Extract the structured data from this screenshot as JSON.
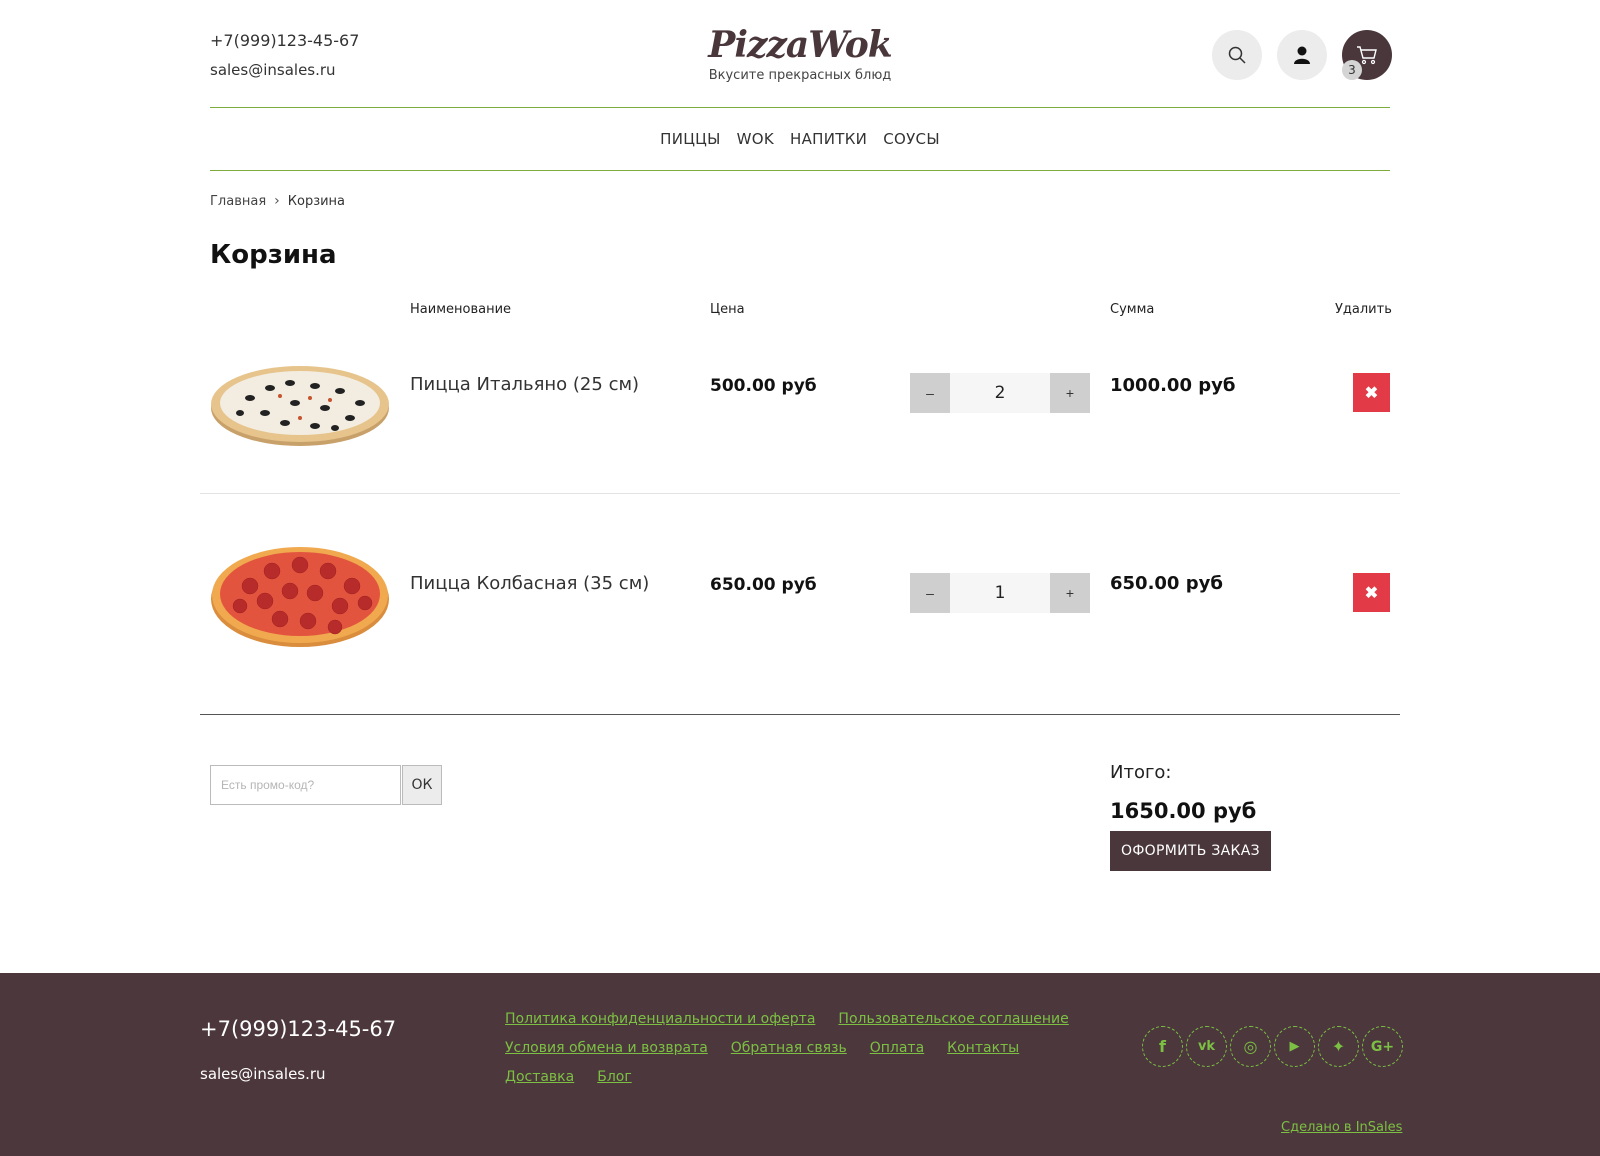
{
  "header": {
    "phone": "+7(999)123-45-67",
    "email": "sales@insales.ru",
    "logo": "PizzaWok",
    "slogan": "Вкусите прекрасных блюд",
    "cart_count": "3"
  },
  "nav": [
    "ПИЦЦЫ",
    "WOK",
    "НАПИТКИ",
    "СОУСЫ"
  ],
  "breadcrumb": {
    "home": "Главная",
    "current": "Корзина"
  },
  "page_title": "Корзина",
  "table_headers": {
    "name": "Наименование",
    "price": "Цена",
    "sum": "Сумма",
    "delete": "Удалить"
  },
  "items": [
    {
      "title": "Пицца Итальяно (25 см)",
      "price": "500.00 руб",
      "qty": "2",
      "sum": "1000.00 руб"
    },
    {
      "title": "Пицца Колбасная (35 см)",
      "price": "650.00 руб",
      "qty": "1",
      "sum": "650.00 руб"
    }
  ],
  "qty_minus": "–",
  "qty_plus": "+",
  "delete_glyph": "✖",
  "promo": {
    "placeholder": "Есть промо-код?",
    "button": "ОК"
  },
  "total": {
    "label": "Итого:",
    "amount": "1650.00 руб",
    "checkout": "ОФОРМИТЬ ЗАКАЗ"
  },
  "footer": {
    "phone": "+7(999)123-45-67",
    "email": "sales@insales.ru",
    "links": [
      "Политика конфиденциальности и оферта",
      "Пользовательское соглашение",
      "Условия обмена и возврата",
      "Обратная связь",
      "Оплата",
      "Контакты",
      "Доставка",
      "Блог"
    ],
    "socials": [
      {
        "icon": "facebook-icon",
        "glyph": "f"
      },
      {
        "icon": "vk-icon",
        "glyph": "vk"
      },
      {
        "icon": "instagram-icon",
        "glyph": "◎"
      },
      {
        "icon": "youtube-icon",
        "glyph": "▶"
      },
      {
        "icon": "twitter-icon",
        "glyph": "✦"
      },
      {
        "icon": "google-plus-icon",
        "glyph": "G+"
      }
    ],
    "made_by": "Сделано в InSales"
  },
  "colors": {
    "brand": "#4a373b",
    "accent": "#7cc043",
    "delete": "#e23b47"
  }
}
